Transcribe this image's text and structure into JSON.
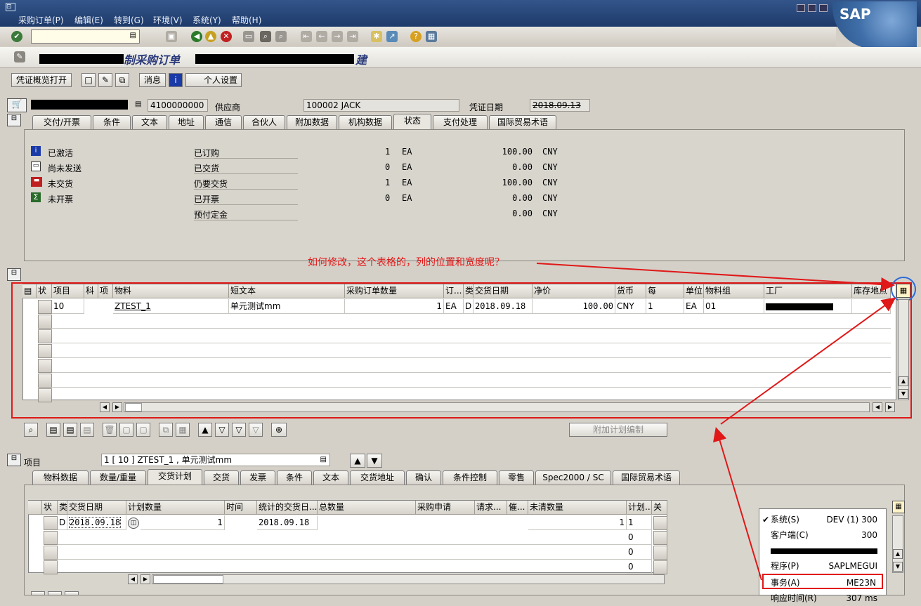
{
  "menu": {
    "items": [
      "采购订单(P)",
      "编辑(E)",
      "转到(G)",
      "环境(V)",
      "系统(Y)",
      "帮助(H)"
    ],
    "logo": "SAP"
  },
  "title": {
    "visible": "制采购订单",
    "suffix": "建"
  },
  "app_toolbar": {
    "overview_btn": "凭证概览打开",
    "messages_btn": "消息",
    "personal_btn": "个人设置"
  },
  "header": {
    "po_number": "4100000000",
    "vendor_label": "供应商",
    "vendor_value": "100002 JACK",
    "doc_date_label": "凭证日期",
    "doc_date_value": "2018.09.13"
  },
  "header_tabs": [
    "交付/开票",
    "条件",
    "文本",
    "地址",
    "通信",
    "合伙人",
    "附加数据",
    "机构数据",
    "状态",
    "支付处理",
    "国际贸易术语"
  ],
  "header_active_tab": "状态",
  "status_flags": [
    {
      "icon": "info-icon",
      "label": "已激活"
    },
    {
      "icon": "printer-icon",
      "label": "尚未发送"
    },
    {
      "icon": "truck-icon",
      "label": "未交货"
    },
    {
      "icon": "sigma-icon",
      "label": "未开票"
    }
  ],
  "status_amounts": [
    {
      "label": "已订购",
      "qty": "1",
      "unit": "EA",
      "amount": "100.00",
      "cur": "CNY"
    },
    {
      "label": "已交货",
      "qty": "0",
      "unit": "EA",
      "amount": "0.00",
      "cur": "CNY"
    },
    {
      "label": "仍要交货",
      "qty": "1",
      "unit": "EA",
      "amount": "100.00",
      "cur": "CNY"
    },
    {
      "label": "已开票",
      "qty": "0",
      "unit": "EA",
      "amount": "0.00",
      "cur": "CNY"
    },
    {
      "label": "预付定金",
      "qty": "",
      "unit": "",
      "amount": "0.00",
      "cur": "CNY"
    }
  ],
  "annotation": "如何修改，这个表格的，列的位置和宽度呢？",
  "items_grid": {
    "columns": [
      "状",
      "项目",
      "科",
      "项",
      "物料",
      "短文本",
      "采购订单数量",
      "订...",
      "类",
      "交货日期",
      "净价",
      "货币",
      "每",
      "单位",
      "物料组",
      "工厂",
      "库存地点"
    ],
    "row": {
      "item": "10",
      "material": "ZTEST_1",
      "short_text": "单元测试mm",
      "qty": "1",
      "oun": "EA",
      "cat": "D",
      "deliv_date": "2018.09.18",
      "net_price": "100.00",
      "currency": "CNY",
      "per": "1",
      "unit": "EA",
      "mat_group": "01"
    }
  },
  "sched_button": "附加计划编制",
  "item_detail": {
    "label": "项目",
    "selector": "1 [ 10 ] ZTEST_1 , 单元测试mm"
  },
  "item_tabs": [
    "物料数据",
    "数量/重量",
    "交货计划",
    "交货",
    "发票",
    "条件",
    "文本",
    "交货地址",
    "确认",
    "条件控制",
    "零售",
    "Spec2000 / SC",
    "国际贸易术语"
  ],
  "item_active_tab": "交货计划",
  "sched_grid": {
    "columns": [
      "状",
      "类",
      "交货日期",
      "计划数量",
      "时间",
      "统计的交货日...",
      "总数量",
      "采购申请",
      "请求...",
      "催...",
      "未清数量",
      "计划...",
      "关"
    ],
    "row": {
      "cat": "D",
      "date": "2018.09.18",
      "qty": "1",
      "stat_date": "2018.09.18",
      "open_qty": "1",
      "plan": "1"
    },
    "extra_plan": [
      "0",
      "0",
      "0"
    ]
  },
  "sys_popup": [
    {
      "k": "系统(S)",
      "v": "DEV (1) 300"
    },
    {
      "k": "客户端(C)",
      "v": "300"
    },
    {
      "k": "程序(P)",
      "v": "SAPLMEGUI"
    },
    {
      "k": "事务(A)",
      "v": "ME23N"
    },
    {
      "k": "响应时间(R)",
      "v": "307 ms"
    }
  ]
}
